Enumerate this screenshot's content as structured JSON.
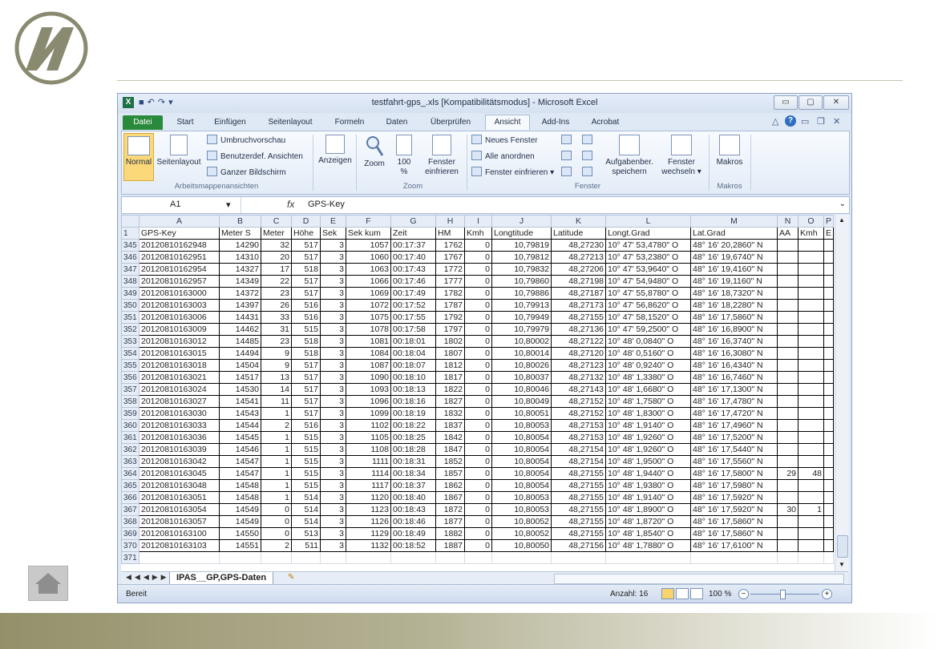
{
  "window": {
    "title": "testfahrt-gps_.xls  [Kompatibilitätsmodus]  -  Microsoft Excel",
    "minimize": "▭",
    "maximize": "▢",
    "close": "✕"
  },
  "tabs": [
    "Datei",
    "Start",
    "Einfügen",
    "Seitenlayout",
    "Formeln",
    "Daten",
    "Überprüfen",
    "Ansicht",
    "Add-Ins",
    "Acrobat"
  ],
  "ribbon": {
    "normal": "Normal",
    "seitenlayout": "Seitenlayout",
    "umbruch": "Umbruchvorschau",
    "benutzerdef": "Benutzerdef. Ansichten",
    "ganzer_bildschirm": "Ganzer Bildschirm",
    "group_views": "Arbeitsmappenansichten",
    "anzeigen": "Anzeigen",
    "zoom": "Zoom",
    "zoom100_a": "100",
    "zoom100_b": "%",
    "fenster_einfrieren_a": "Fenster",
    "fenster_einfrieren_b": "einfrieren",
    "group_zoom": "Zoom",
    "neues_fenster": "Neues Fenster",
    "alle_anordnen": "Alle anordnen",
    "fenster_einfrieren": "Fenster einfrieren",
    "aufgabenber_a": "Aufgabenber.",
    "aufgabenber_b": "speichern",
    "fenster_wechseln_a": "Fenster",
    "fenster_wechseln_b": "wechseln",
    "group_fenster": "Fenster",
    "makros": "Makros",
    "group_makros": "Makros"
  },
  "formula_bar": {
    "name_box": "A1",
    "fx": "fx",
    "value": "GPS-Key"
  },
  "grid": {
    "columns": [
      "A",
      "B",
      "C",
      "D",
      "E",
      "F",
      "G",
      "H",
      "I",
      "J",
      "K",
      "L",
      "M",
      "N",
      "O",
      "P"
    ],
    "header_row_number": "1",
    "headers": [
      "GPS-Key",
      "Meter S",
      "Meter",
      "Höhe",
      "Sek",
      "Sek kum",
      "Zeit",
      "HM",
      "Kmh",
      "Longtitude",
      "Latitude",
      "Longt.Grad",
      "Lat.Grad",
      "AA",
      "Kmh",
      "E"
    ],
    "rows": [
      {
        "n": "345",
        "cells": [
          "20120810162948",
          "14290",
          "32",
          "517",
          "3",
          "1057",
          "00:17:37",
          "1762",
          "0",
          "10,79819",
          "48,27230",
          "10° 47' 53,4780\" O",
          "48° 16' 20,2860\" N",
          "",
          ""
        ]
      },
      {
        "n": "346",
        "cells": [
          "20120810162951",
          "14310",
          "20",
          "517",
          "3",
          "1060",
          "00:17:40",
          "1767",
          "0",
          "10,79812",
          "48,27213",
          "10° 47' 53,2380\" O",
          "48° 16' 19,6740\" N",
          "",
          ""
        ]
      },
      {
        "n": "347",
        "cells": [
          "20120810162954",
          "14327",
          "17",
          "518",
          "3",
          "1063",
          "00:17:43",
          "1772",
          "0",
          "10,79832",
          "48,27206",
          "10° 47' 53,9640\" O",
          "48° 16' 19,4160\" N",
          "",
          ""
        ]
      },
      {
        "n": "348",
        "cells": [
          "20120810162957",
          "14349",
          "22",
          "517",
          "3",
          "1066",
          "00:17:46",
          "1777",
          "0",
          "10,79860",
          "48,27198",
          "10° 47' 54,9480\" O",
          "48° 16' 19,1160\" N",
          "",
          ""
        ]
      },
      {
        "n": "349",
        "cells": [
          "20120810163000",
          "14372",
          "23",
          "517",
          "3",
          "1069",
          "00:17:49",
          "1782",
          "0",
          "10,79886",
          "48,27187",
          "10° 47' 55,8780\" O",
          "48° 16' 18,7320\" N",
          "",
          ""
        ]
      },
      {
        "n": "350",
        "cells": [
          "20120810163003",
          "14397",
          "26",
          "516",
          "3",
          "1072",
          "00:17:52",
          "1787",
          "0",
          "10,79913",
          "48,27173",
          "10° 47' 56,8620\" O",
          "48° 16' 18,2280\" N",
          "",
          ""
        ]
      },
      {
        "n": "351",
        "cells": [
          "20120810163006",
          "14431",
          "33",
          "516",
          "3",
          "1075",
          "00:17:55",
          "1792",
          "0",
          "10,79949",
          "48,27155",
          "10° 47' 58,1520\" O",
          "48° 16' 17,5860\" N",
          "",
          ""
        ]
      },
      {
        "n": "352",
        "cells": [
          "20120810163009",
          "14462",
          "31",
          "515",
          "3",
          "1078",
          "00:17:58",
          "1797",
          "0",
          "10,79979",
          "48,27136",
          "10° 47' 59,2500\" O",
          "48° 16' 16,8900\" N",
          "",
          ""
        ]
      },
      {
        "n": "353",
        "cells": [
          "20120810163012",
          "14485",
          "23",
          "518",
          "3",
          "1081",
          "00:18:01",
          "1802",
          "0",
          "10,80002",
          "48,27122",
          "10° 48' 0,0840\" O",
          "48° 16' 16,3740\" N",
          "",
          ""
        ]
      },
      {
        "n": "354",
        "cells": [
          "20120810163015",
          "14494",
          "9",
          "518",
          "3",
          "1084",
          "00:18:04",
          "1807",
          "0",
          "10,80014",
          "48,27120",
          "10° 48' 0,5160\" O",
          "48° 16' 16,3080\" N",
          "",
          ""
        ]
      },
      {
        "n": "355",
        "cells": [
          "20120810163018",
          "14504",
          "9",
          "517",
          "3",
          "1087",
          "00:18:07",
          "1812",
          "0",
          "10,80026",
          "48,27123",
          "10° 48' 0,9240\" O",
          "48° 16' 16,4340\" N",
          "",
          ""
        ]
      },
      {
        "n": "356",
        "cells": [
          "20120810163021",
          "14517",
          "13",
          "517",
          "3",
          "1090",
          "00:18:10",
          "1817",
          "0",
          "10,80037",
          "48,27132",
          "10° 48' 1,3380\" O",
          "48° 16' 16,7460\" N",
          "",
          ""
        ]
      },
      {
        "n": "357",
        "cells": [
          "20120810163024",
          "14530",
          "14",
          "517",
          "3",
          "1093",
          "00:18:13",
          "1822",
          "0",
          "10,80046",
          "48,27143",
          "10° 48' 1,6680\" O",
          "48° 16' 17,1300\" N",
          "",
          ""
        ]
      },
      {
        "n": "358",
        "cells": [
          "20120810163027",
          "14541",
          "11",
          "517",
          "3",
          "1096",
          "00:18:16",
          "1827",
          "0",
          "10,80049",
          "48,27152",
          "10° 48' 1,7580\" O",
          "48° 16' 17,4780\" N",
          "",
          ""
        ]
      },
      {
        "n": "359",
        "cells": [
          "20120810163030",
          "14543",
          "1",
          "517",
          "3",
          "1099",
          "00:18:19",
          "1832",
          "0",
          "10,80051",
          "48,27152",
          "10° 48' 1,8300\" O",
          "48° 16' 17,4720\" N",
          "",
          ""
        ]
      },
      {
        "n": "360",
        "cells": [
          "20120810163033",
          "14544",
          "2",
          "516",
          "3",
          "1102",
          "00:18:22",
          "1837",
          "0",
          "10,80053",
          "48,27153",
          "10° 48' 1,9140\" O",
          "48° 16' 17,4960\" N",
          "",
          ""
        ]
      },
      {
        "n": "361",
        "cells": [
          "20120810163036",
          "14545",
          "1",
          "515",
          "3",
          "1105",
          "00:18:25",
          "1842",
          "0",
          "10,80054",
          "48,27153",
          "10° 48' 1,9260\" O",
          "48° 16' 17,5200\" N",
          "",
          ""
        ]
      },
      {
        "n": "362",
        "cells": [
          "20120810163039",
          "14546",
          "1",
          "515",
          "3",
          "1108",
          "00:18:28",
          "1847",
          "0",
          "10,80054",
          "48,27154",
          "10° 48' 1,9260\" O",
          "48° 16' 17,5440\" N",
          "",
          ""
        ]
      },
      {
        "n": "363",
        "cells": [
          "20120810163042",
          "14547",
          "1",
          "515",
          "3",
          "1111",
          "00:18:31",
          "1852",
          "0",
          "10,80054",
          "48,27154",
          "10° 48' 1,9500\" O",
          "48° 16' 17,5560\" N",
          "",
          ""
        ]
      },
      {
        "n": "364",
        "cells": [
          "20120810163045",
          "14547",
          "1",
          "515",
          "3",
          "1114",
          "00:18:34",
          "1857",
          "0",
          "10,80054",
          "48,27155",
          "10° 48' 1,9440\" O",
          "48° 16' 17,5800\" N",
          "29",
          "48"
        ]
      },
      {
        "n": "365",
        "cells": [
          "20120810163048",
          "14548",
          "1",
          "515",
          "3",
          "1117",
          "00:18:37",
          "1862",
          "0",
          "10,80054",
          "48,27155",
          "10° 48' 1,9380\" O",
          "48° 16' 17,5980\" N",
          "",
          ""
        ]
      },
      {
        "n": "366",
        "cells": [
          "20120810163051",
          "14548",
          "1",
          "514",
          "3",
          "1120",
          "00:18:40",
          "1867",
          "0",
          "10,80053",
          "48,27155",
          "10° 48' 1,9140\" O",
          "48° 16' 17,5920\" N",
          "",
          ""
        ]
      },
      {
        "n": "367",
        "cells": [
          "20120810163054",
          "14549",
          "0",
          "514",
          "3",
          "1123",
          "00:18:43",
          "1872",
          "0",
          "10,80053",
          "48,27155",
          "10° 48' 1,8900\" O",
          "48° 16' 17,5920\" N",
          "30",
          "1"
        ]
      },
      {
        "n": "368",
        "cells": [
          "20120810163057",
          "14549",
          "0",
          "514",
          "3",
          "1126",
          "00:18:46",
          "1877",
          "0",
          "10,80052",
          "48,27155",
          "10° 48' 1,8720\" O",
          "48° 16' 17,5860\" N",
          "",
          ""
        ]
      },
      {
        "n": "369",
        "cells": [
          "20120810163100",
          "14550",
          "0",
          "513",
          "3",
          "1129",
          "00:18:49",
          "1882",
          "0",
          "10,80052",
          "48,27155",
          "10° 48' 1,8540\" O",
          "48° 16' 17,5860\" N",
          "",
          ""
        ]
      },
      {
        "n": "370",
        "cells": [
          "20120810163103",
          "14551",
          "2",
          "511",
          "3",
          "1132",
          "00:18:52",
          "1887",
          "0",
          "10,80050",
          "48,27156",
          "10° 48' 1,7880\" O",
          "48° 16' 17,6100\" N",
          "",
          ""
        ]
      }
    ],
    "last_row_number": "371"
  },
  "sheet_tab": "IPAS__GP,GPS-Daten",
  "status": {
    "ready": "Bereit",
    "count": "Anzahl: 16",
    "zoom": "100 %"
  },
  "colors": {
    "file_tab": "#2a8a3c",
    "footer_band": "#93916a"
  }
}
